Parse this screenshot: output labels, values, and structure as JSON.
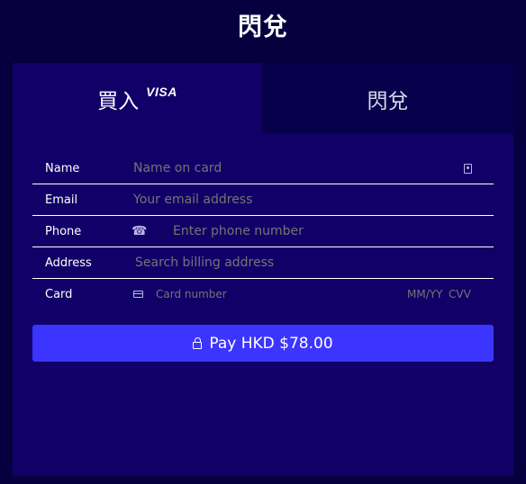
{
  "header": {
    "title": "閃兌"
  },
  "tabs": [
    {
      "label": "買入",
      "logo": "VISA",
      "active": true
    },
    {
      "label": "閃兌",
      "active": false
    }
  ],
  "form": {
    "name": {
      "label": "Name",
      "placeholder": "Name on card",
      "icon": "contact-card-icon"
    },
    "email": {
      "label": "Email",
      "placeholder": "Your email address"
    },
    "phone": {
      "label": "Phone",
      "placeholder": "Enter phone number",
      "icon": "phone-globe-icon"
    },
    "address": {
      "label": "Address",
      "placeholder": "Search billing address"
    },
    "card": {
      "label": "Card",
      "number_placeholder": "Card number",
      "expiry_placeholder": "MM/YY",
      "cvv_placeholder": "CVV",
      "icon": "credit-card-icon"
    }
  },
  "pay_button": {
    "label": "Pay HKD $78.00",
    "icon": "lock-icon"
  },
  "colors": {
    "page_bg": "#06003f",
    "panel_bg": "#110068",
    "inactive_tab_bg": "#07004a",
    "button_bg": "#3c35ff",
    "placeholder": "#b9b6e6"
  }
}
